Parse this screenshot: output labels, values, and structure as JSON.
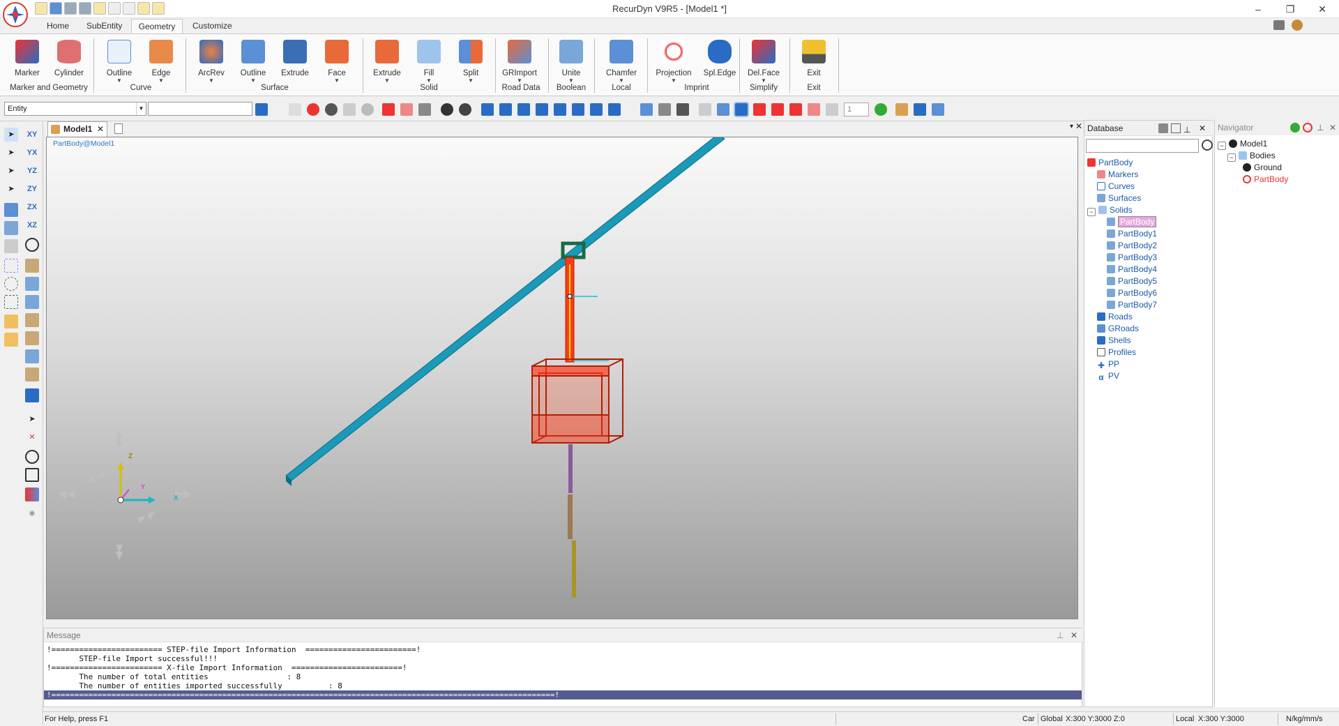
{
  "window": {
    "title": "RecurDyn V9R5 - [Model1 *]"
  },
  "ribbon": {
    "tabs": [
      "Home",
      "SubEntity",
      "Geometry",
      "Customize"
    ],
    "active_tab": "Geometry",
    "buttons": [
      "Marker",
      "Cylinder",
      "Outline",
      "Edge",
      "ArcRev",
      "Outline",
      "Extrude",
      "Face",
      "Extrude",
      "Fill",
      "Split",
      "GRImport",
      "Unite",
      "Chamfer",
      "Projection",
      "Spl.Edge",
      "Del.Face",
      "Exit"
    ],
    "groups": [
      "Marker and Geometry",
      "Curve",
      "Surface",
      "Solid",
      "Road Data",
      "Boolean",
      "Local",
      "Imprint",
      "Simplify",
      "Exit"
    ]
  },
  "toolbar": {
    "entity_value": "Entity",
    "page_value": "1"
  },
  "document": {
    "tab": "Model1",
    "viewport_label": "PartBody@Model1",
    "axes": {
      "x": "X",
      "y": "Y",
      "z": "Z"
    }
  },
  "left_tools": {
    "view_labels": [
      "XY",
      "YX",
      "YZ",
      "ZY",
      "ZX",
      "XZ"
    ]
  },
  "database": {
    "title": "Database",
    "root": "PartBody",
    "categories_top": [
      "Markers",
      "Curves",
      "Surfaces",
      "Solids"
    ],
    "solids": [
      "PartBody",
      "PartBody1",
      "PartBody2",
      "PartBody3",
      "PartBody4",
      "PartBody5",
      "PartBody6",
      "PartBody7"
    ],
    "categories_bottom": [
      "Roads",
      "GRoads",
      "Shells",
      "Profiles",
      "PP",
      "PV"
    ]
  },
  "navigator": {
    "title": "Navigator",
    "model": "Model1",
    "bodies": "Bodies",
    "ground": "Ground",
    "partbody": "PartBody"
  },
  "messages": {
    "title": "Message",
    "lines": [
      "!======================== STEP-file Import Information  ========================!",
      "       STEP-file Import successful!!!",
      "!======================== X-file Import Information  ========================!",
      "       The number of total entities                 : 8",
      "       The number of entities imported successfully          : 8",
      "!=============================================================================================================!"
    ]
  },
  "statusbar": {
    "help": "For Help, press F1",
    "unit_sys": "Car",
    "coord_system": "Global",
    "global_coords": "X:300 Y:3000 Z:0",
    "local_label": "Local",
    "local_coords": "X:300 Y:3000",
    "units": "N/kg/mm/s"
  },
  "colors": {
    "rail": "#1a9ab8",
    "frame": "#ff3a1a",
    "accent": "#2d77c9",
    "message_highlight": "#555c90"
  }
}
